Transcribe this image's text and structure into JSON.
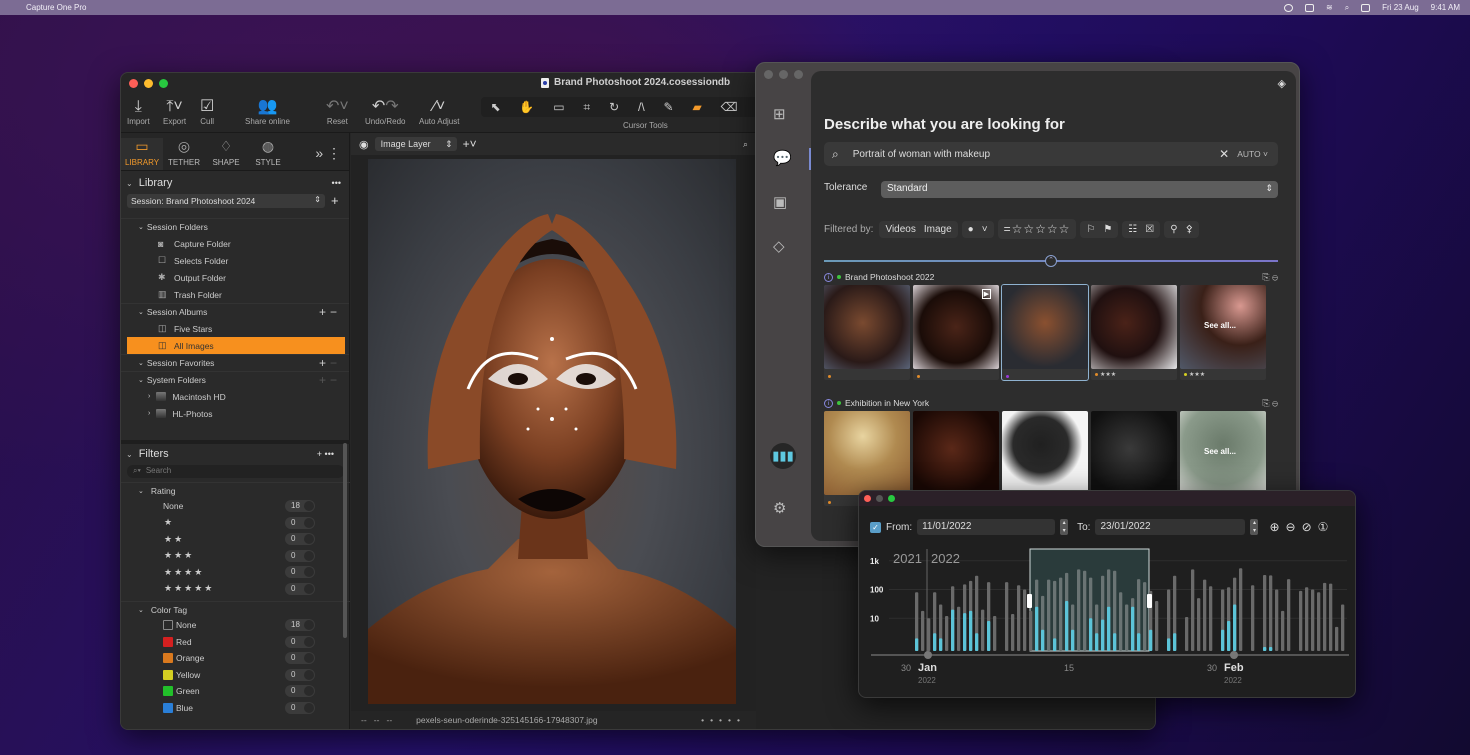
{
  "menubar": {
    "app_name": "Capture One Pro",
    "date": "Fri 23 Aug",
    "time": "9:41 AM",
    "icons": [
      "apple-icon",
      "siri-icon",
      "battery-icon",
      "wifi-icon",
      "spotlight-icon",
      "control-center-icon"
    ]
  },
  "main_window": {
    "title": "Brand Photoshoot 2024.cosessiondb",
    "toolbar": {
      "import": "Import",
      "export": "Export",
      "cull": "Cull",
      "share": "Share online",
      "reset": "Reset",
      "undo_redo": "Undo/Redo",
      "auto_adjust": "Auto Adjust",
      "cursor_tools": "Cursor Tools"
    },
    "tool_tabs": [
      {
        "label": "LIBRARY",
        "icon": "folder-icon",
        "active": true
      },
      {
        "label": "TETHER",
        "icon": "camera-tether-icon",
        "active": false
      },
      {
        "label": "SHAPE",
        "icon": "shape-icon",
        "active": false
      },
      {
        "label": "STYLE",
        "icon": "style-icon",
        "active": false
      }
    ],
    "library": {
      "title": "Library",
      "session": "Session: Brand Photoshoot 2024",
      "session_folders": {
        "label": "Session Folders",
        "items": [
          "Capture Folder",
          "Selects Folder",
          "Output Folder",
          "Trash Folder"
        ]
      },
      "session_albums": {
        "label": "Session Albums",
        "items": [
          "Five Stars",
          "All Images"
        ],
        "selected": "All Images"
      },
      "session_favorites": "Session Favorites",
      "system_folders": {
        "label": "System Folders",
        "items": [
          "Macintosh HD",
          "HL-Photos"
        ]
      }
    },
    "filters": {
      "title": "Filters",
      "search_placeholder": "Search",
      "rating": {
        "label": "Rating",
        "rows": [
          {
            "label": "None",
            "count": "18"
          },
          {
            "label": "★",
            "count": "0"
          },
          {
            "label": "★★",
            "count": "0"
          },
          {
            "label": "★★★",
            "count": "0"
          },
          {
            "label": "★★★★",
            "count": "0"
          },
          {
            "label": "★★★★★",
            "count": "0"
          }
        ]
      },
      "color_tag": {
        "label": "Color Tag",
        "rows": [
          {
            "label": "None",
            "count": "18",
            "color": ""
          },
          {
            "label": "Red",
            "count": "0",
            "color": "#d42020"
          },
          {
            "label": "Orange",
            "count": "0",
            "color": "#d9791e"
          },
          {
            "label": "Yellow",
            "count": "0",
            "color": "#d4cf22"
          },
          {
            "label": "Green",
            "count": "0",
            "color": "#22c02a"
          },
          {
            "label": "Blue",
            "count": "0",
            "color": "#2a7fd8"
          }
        ]
      }
    },
    "viewer": {
      "layer": "Image Layer",
      "filename": "pexels-seun-oderinde-325145166-17948307.jpg",
      "left_placeholders": "--   --   --"
    }
  },
  "search_window": {
    "heading": "Describe what you are looking for",
    "query": "Portrait of woman with makeup",
    "mode": "AUTO",
    "tolerance_label": "Tolerance",
    "tolerance_value": "Standard",
    "filtered_by_label": "Filtered by:",
    "filter_videos": "Videos",
    "filter_image": "Image",
    "rating_filter": "=☆☆☆☆☆",
    "albums": [
      {
        "name": "Brand Photoshoot 2022",
        "see_all": "See all...",
        "thumbs": [
          {
            "tag": "#e08b2a",
            "stars": ""
          },
          {
            "tag": "#e08b2a",
            "stars": ""
          },
          {
            "tag": "#9a3ad8",
            "stars": ""
          },
          {
            "tag": "#e08b2a",
            "stars": "★★★"
          },
          {
            "tag": "#d4cf22",
            "stars": "★★★"
          }
        ]
      },
      {
        "name": "Exhibition in New York",
        "see_all": "See all...",
        "thumbs": [
          {
            "tag": "#e08b2a",
            "stars": ""
          },
          {
            "tag": "",
            "stars": ""
          },
          {
            "tag": "",
            "stars": ""
          },
          {
            "tag": "",
            "stars": ""
          },
          {
            "tag": "",
            "stars": ""
          }
        ]
      }
    ]
  },
  "timeline_window": {
    "from_label": "From:",
    "from_value": "11/01/2022",
    "to_label": "To:",
    "to_value": "23/01/2022",
    "from_enabled": true,
    "chart_data": {
      "type": "bar",
      "scale": "log",
      "year_labels": [
        "2021",
        "2022"
      ],
      "ytick_labels": [
        "1k",
        "100",
        "10"
      ],
      "yticks": [
        1000,
        100,
        10
      ],
      "xtick_labels": [
        {
          "day": "30",
          "month": "Jan",
          "year": "2022"
        },
        {
          "day": "15",
          "month": "",
          "year": ""
        },
        {
          "day": "30",
          "month": "Feb",
          "year": "2022"
        }
      ],
      "selection": {
        "from": "11/01/2022",
        "to": "23/01/2022"
      },
      "series": [
        {
          "name": "total",
          "values": [
            80,
            18,
            10,
            80,
            30,
            12,
            130,
            25,
            150,
            200,
            300,
            20,
            180,
            12,
            0,
            180,
            14,
            140,
            100,
            18,
            220,
            60,
            220,
            200,
            260,
            380,
            30,
            500,
            450,
            260,
            30,
            300,
            500,
            450,
            80,
            30,
            50,
            230,
            180,
            90,
            40,
            0,
            100,
            300,
            0,
            11,
            500,
            50,
            220,
            130,
            0,
            100,
            120,
            260,
            550,
            0,
            140,
            0,
            320,
            310,
            100,
            18,
            230,
            0,
            90,
            120,
            100,
            80,
            170,
            160,
            5,
            30
          ]
        },
        {
          "name": "matched",
          "values": [
            2,
            0,
            0,
            3,
            2,
            0,
            20,
            0,
            15,
            18,
            3,
            0,
            8,
            0,
            0,
            0,
            0,
            0,
            0,
            0,
            25,
            4,
            0,
            2,
            0,
            40,
            4,
            0,
            0,
            10,
            3,
            9,
            25,
            3,
            0,
            0,
            25,
            3,
            0,
            4,
            0,
            0,
            2,
            3,
            0,
            0,
            0,
            0,
            0,
            0,
            0,
            4,
            8,
            30,
            0,
            0,
            0,
            0,
            1,
            1,
            0,
            0,
            0,
            0,
            0,
            0,
            0,
            0,
            0,
            0,
            0,
            0
          ]
        }
      ]
    }
  }
}
